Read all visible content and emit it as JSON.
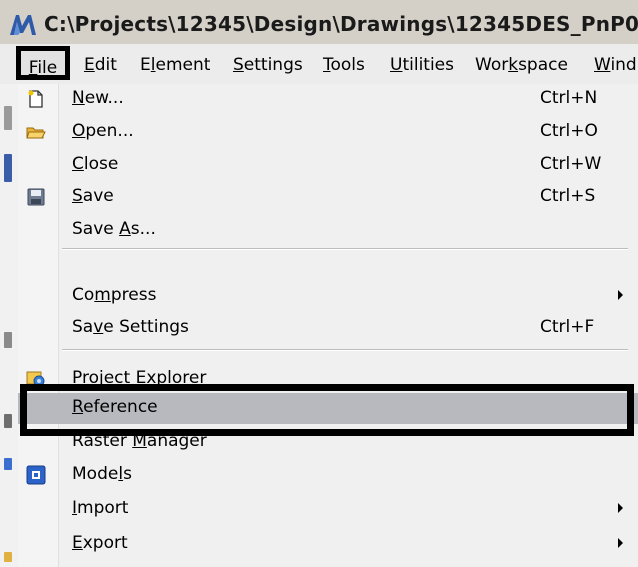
{
  "window": {
    "title": "C:\\Projects\\12345\\Design\\Drawings\\12345DES_PnP0"
  },
  "menubar": {
    "items": [
      {
        "label": "File",
        "mnemonic": 0
      },
      {
        "label": "Edit",
        "mnemonic": 0
      },
      {
        "label": "Element",
        "mnemonic": 1
      },
      {
        "label": "Settings",
        "mnemonic": 0
      },
      {
        "label": "Tools",
        "mnemonic": 0
      },
      {
        "label": "Utilities",
        "mnemonic": 0
      },
      {
        "label": "Workspace",
        "mnemonic": 3
      },
      {
        "label": "Wind",
        "mnemonic": 0
      }
    ]
  },
  "file_menu": {
    "items": [
      {
        "type": "item",
        "label": "New...",
        "mnemonic": 0,
        "shortcut": "Ctrl+N",
        "icon": "new-file-icon"
      },
      {
        "type": "item",
        "label": "Open...",
        "mnemonic": 0,
        "shortcut": "Ctrl+O",
        "icon": "open-folder-icon"
      },
      {
        "type": "item",
        "label": "Close",
        "mnemonic": 0,
        "shortcut": "Ctrl+W",
        "icon": ""
      },
      {
        "type": "item",
        "label": "Save",
        "mnemonic": 0,
        "shortcut": "Ctrl+S",
        "icon": "floppy-disk-icon"
      },
      {
        "type": "item",
        "label": "Save As...",
        "mnemonic": 5,
        "shortcut": "",
        "icon": ""
      },
      {
        "type": "separator"
      },
      {
        "type": "item",
        "label": "Compress",
        "mnemonic": 2,
        "shortcut": "",
        "submenu": true,
        "icon": ""
      },
      {
        "type": "item",
        "label": "Save Settings",
        "mnemonic": 2,
        "shortcut": "Ctrl+F",
        "icon": ""
      },
      {
        "type": "separator"
      },
      {
        "type": "item",
        "label": "Project Explorer",
        "mnemonic": 9,
        "shortcut": "",
        "icon": "project-explorer-icon"
      },
      {
        "type": "item",
        "label": "Reference",
        "mnemonic": 0,
        "shortcut": "",
        "icon": "",
        "highlighted": true
      },
      {
        "type": "item",
        "label": "Raster Manager",
        "mnemonic": 7,
        "shortcut": "",
        "icon": ""
      },
      {
        "type": "item",
        "label": "Models",
        "mnemonic": 4,
        "shortcut": "",
        "icon": "models-icon"
      },
      {
        "type": "item",
        "label": "Import",
        "mnemonic": 0,
        "shortcut": "",
        "submenu": true,
        "icon": ""
      },
      {
        "type": "item",
        "label": "Export",
        "mnemonic": 0,
        "shortcut": "",
        "submenu": true,
        "icon": ""
      }
    ]
  },
  "colors": {
    "highlight": "#b7b9be",
    "menu_bg": "#f0f0f0",
    "annotation_frame": "#000000"
  }
}
